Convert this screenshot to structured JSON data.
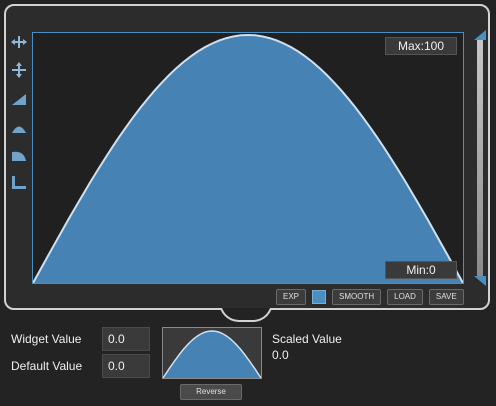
{
  "curve": {
    "max_label": "Max:100",
    "min_label": "Min:0",
    "fill_color": "#4682b4",
    "line_color": "#cfe0ef"
  },
  "tools": [
    "move-horizontal-icon",
    "move-vertical-icon",
    "linear-ramp-icon",
    "half-bell-icon",
    "quarter-round-icon",
    "corner-icon"
  ],
  "buttons": {
    "exp": "EXP",
    "smooth": "SMOOTH",
    "load": "LOAD",
    "save": "SAVE",
    "reverse": "Reverse"
  },
  "values": {
    "widget_label": "Widget Value",
    "widget_value": "0.0",
    "default_label": "Default Value",
    "default_value": "0.0",
    "scaled_label": "Scaled Value",
    "scaled_value": "0.0"
  }
}
